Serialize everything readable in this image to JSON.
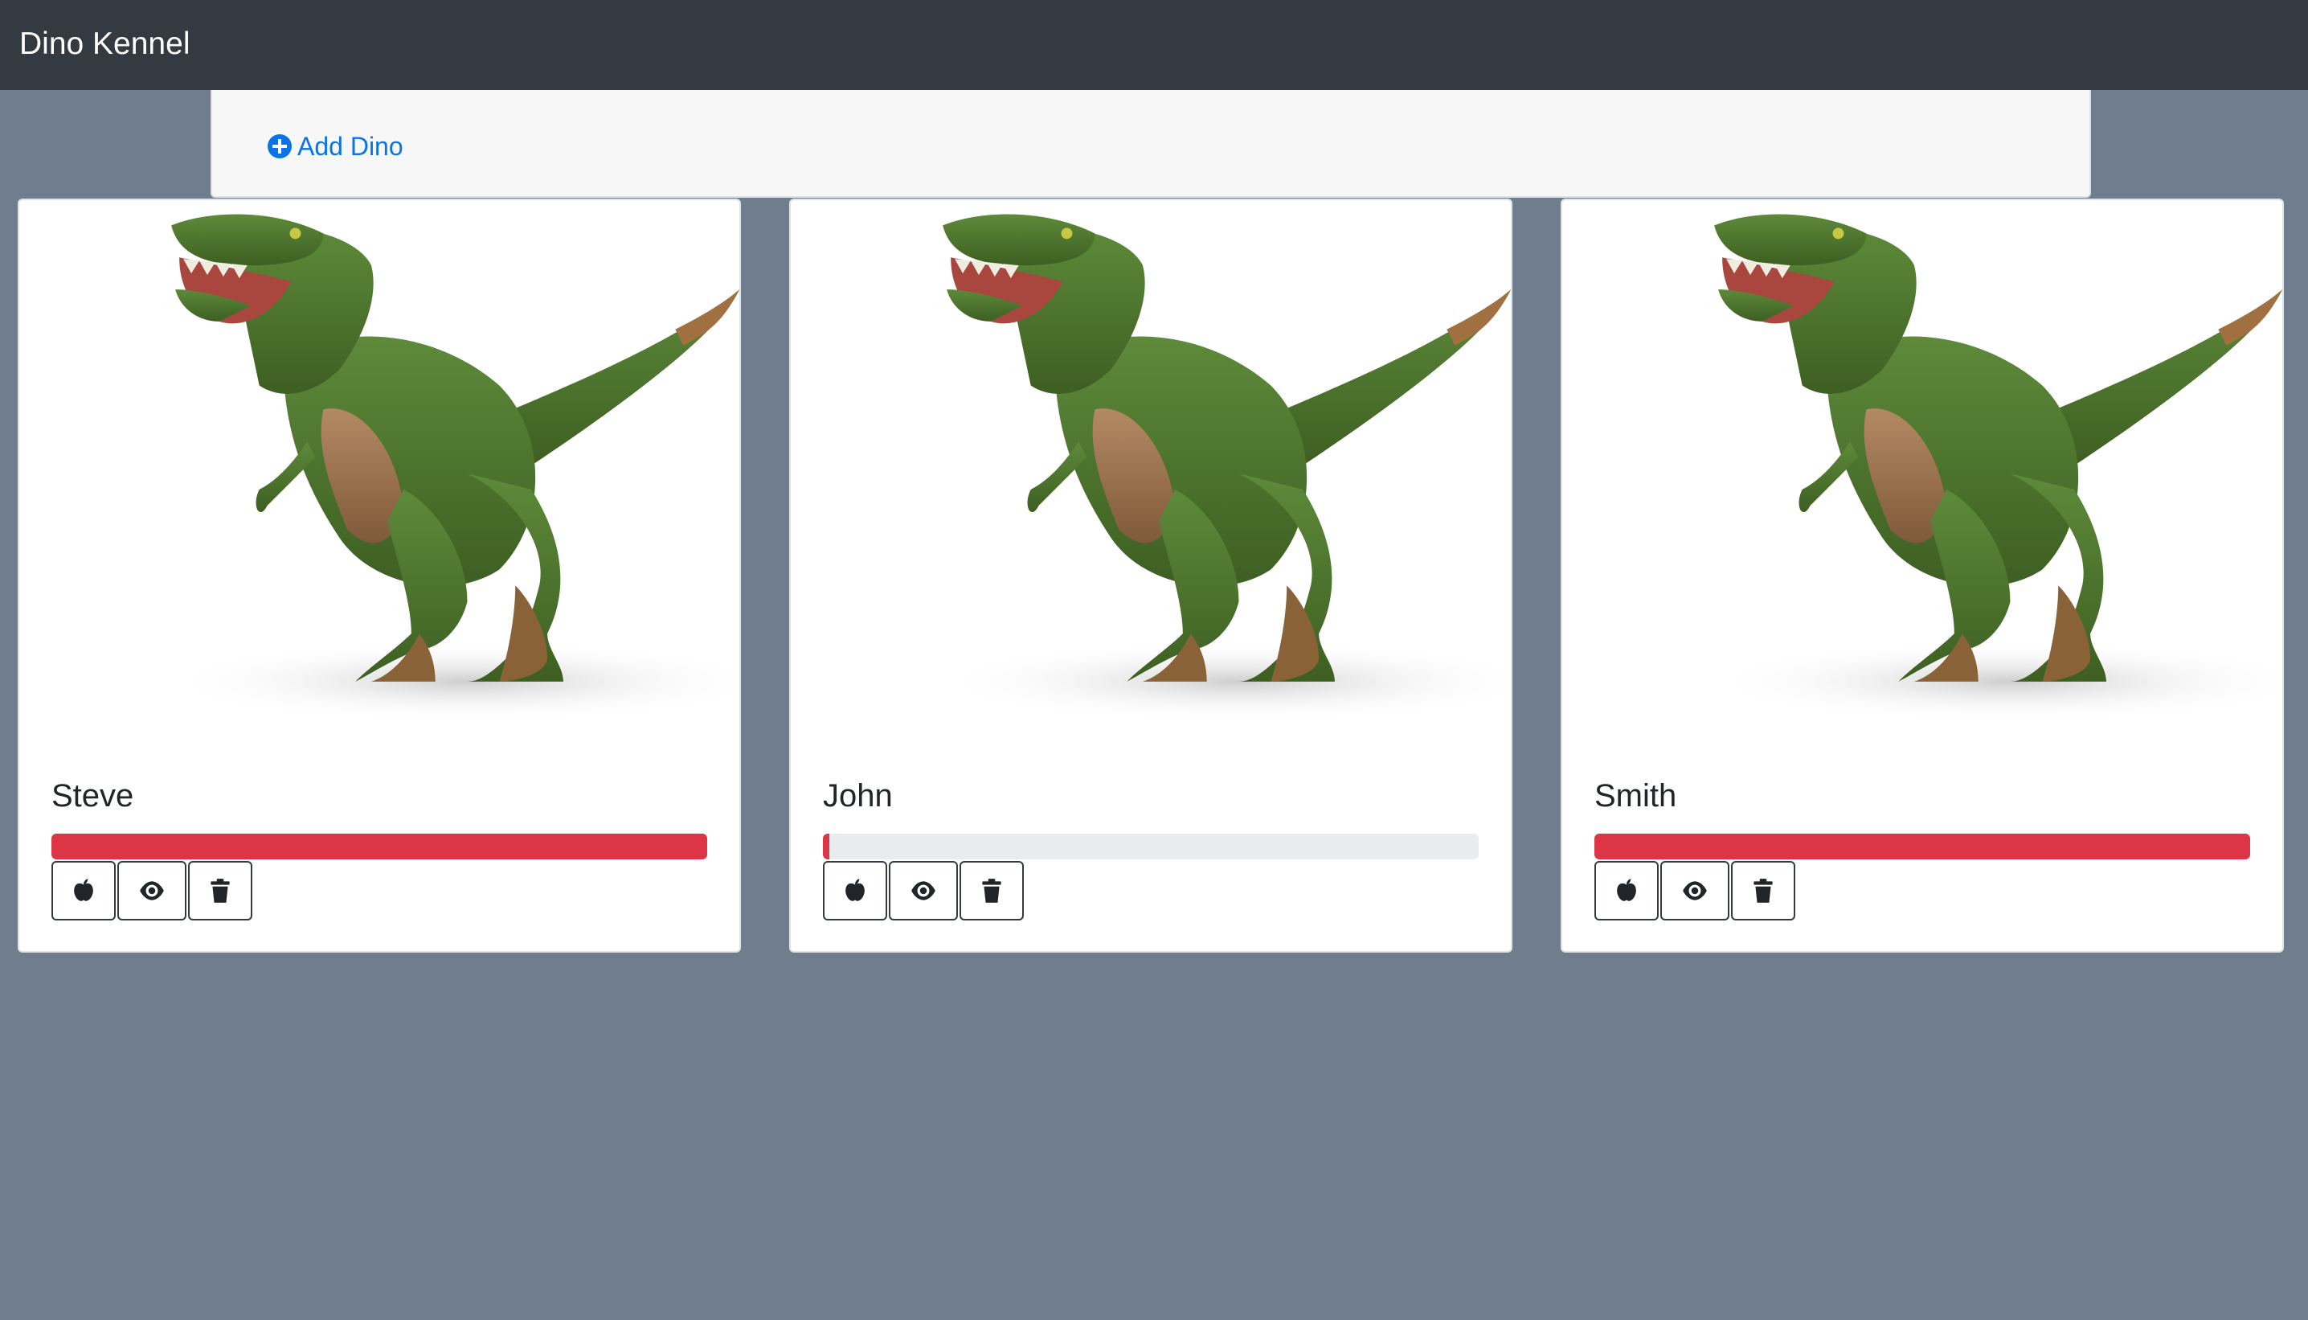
{
  "navbar": {
    "brand": "Dino Kennel"
  },
  "toolbar": {
    "add_label": "Add Dino",
    "add_icon": "plus-circle-icon"
  },
  "colors": {
    "accent": "#0a73e6",
    "danger": "#dc3545",
    "navbar": "#343a42",
    "background": "#6f7d8e"
  },
  "dinos": [
    {
      "name": "Steve",
      "health": 100,
      "image": "t-rex-figure"
    },
    {
      "name": "John",
      "health": 1,
      "image": "t-rex-figure"
    },
    {
      "name": "Smith",
      "health": 100,
      "image": "t-rex-figure"
    }
  ],
  "card_actions": [
    {
      "icon": "apple-icon",
      "action": "feed"
    },
    {
      "icon": "eye-icon",
      "action": "view"
    },
    {
      "icon": "trash-icon",
      "action": "delete"
    }
  ]
}
